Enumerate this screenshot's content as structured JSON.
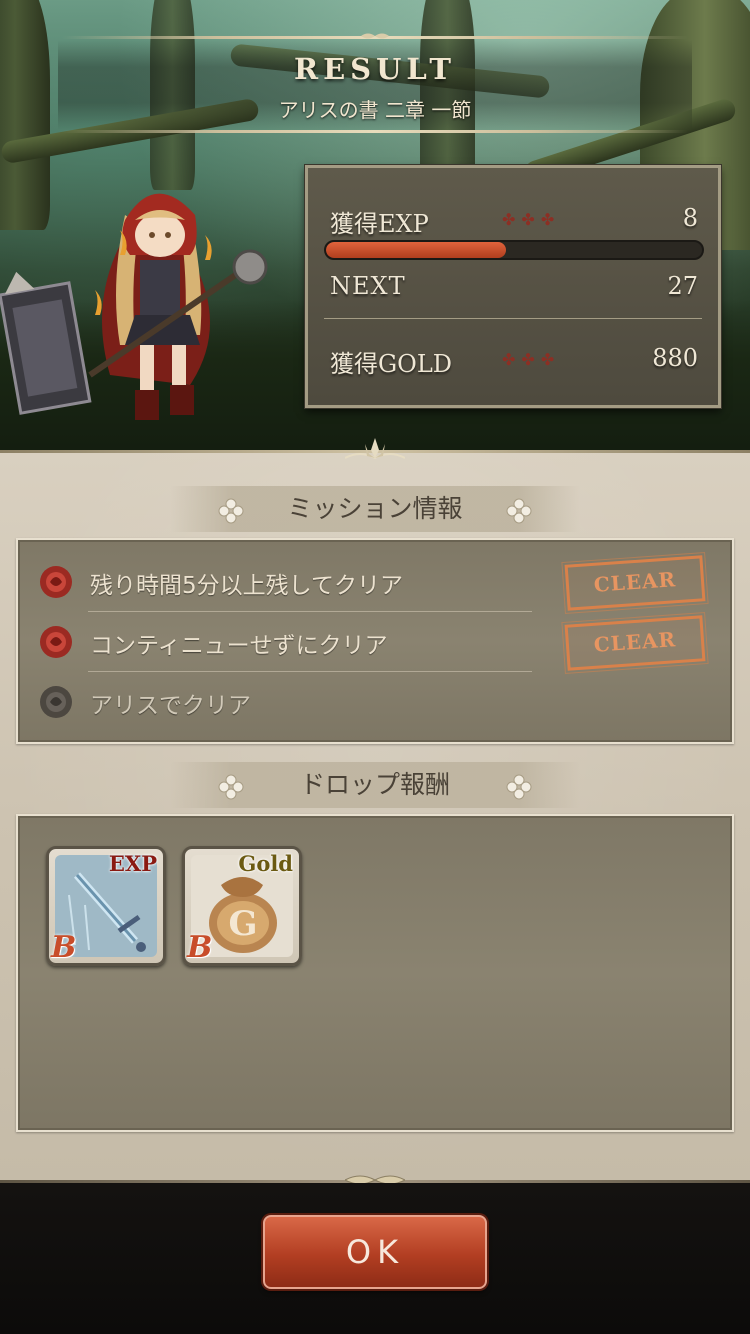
{
  "header": {
    "title": "RESULT",
    "subtitle": "アリスの書 二章 一節"
  },
  "stats": {
    "exp_label": "獲得EXP",
    "exp_value": "8",
    "exp_progress_fraction": 0.48,
    "next_label": "NEXT",
    "next_value": "27",
    "gold_label": "獲得GOLD",
    "gold_value": "880"
  },
  "missions": {
    "header": "ミッション情報",
    "items": [
      {
        "text": "残り時間5分以上残してクリア",
        "status": "CLEAR",
        "cleared": true
      },
      {
        "text": "コンティニューせずにクリア",
        "status": "CLEAR",
        "cleared": true
      },
      {
        "text": "アリスでクリア",
        "status": "",
        "cleared": false
      }
    ]
  },
  "drops": {
    "header": "ドロップ報酬",
    "items": [
      {
        "label": "EXP",
        "rank": "B",
        "icon": "sword-icon",
        "label_color": "#8a1a12"
      },
      {
        "label": "Gold",
        "rank": "B",
        "icon": "gold-bag-icon",
        "label_color": "#6b5a12"
      }
    ]
  },
  "ok_button": "OK",
  "colors": {
    "accent": "#c24a2a",
    "clear_stamp": "#d9814a",
    "exp_bar": "#d4542f"
  }
}
